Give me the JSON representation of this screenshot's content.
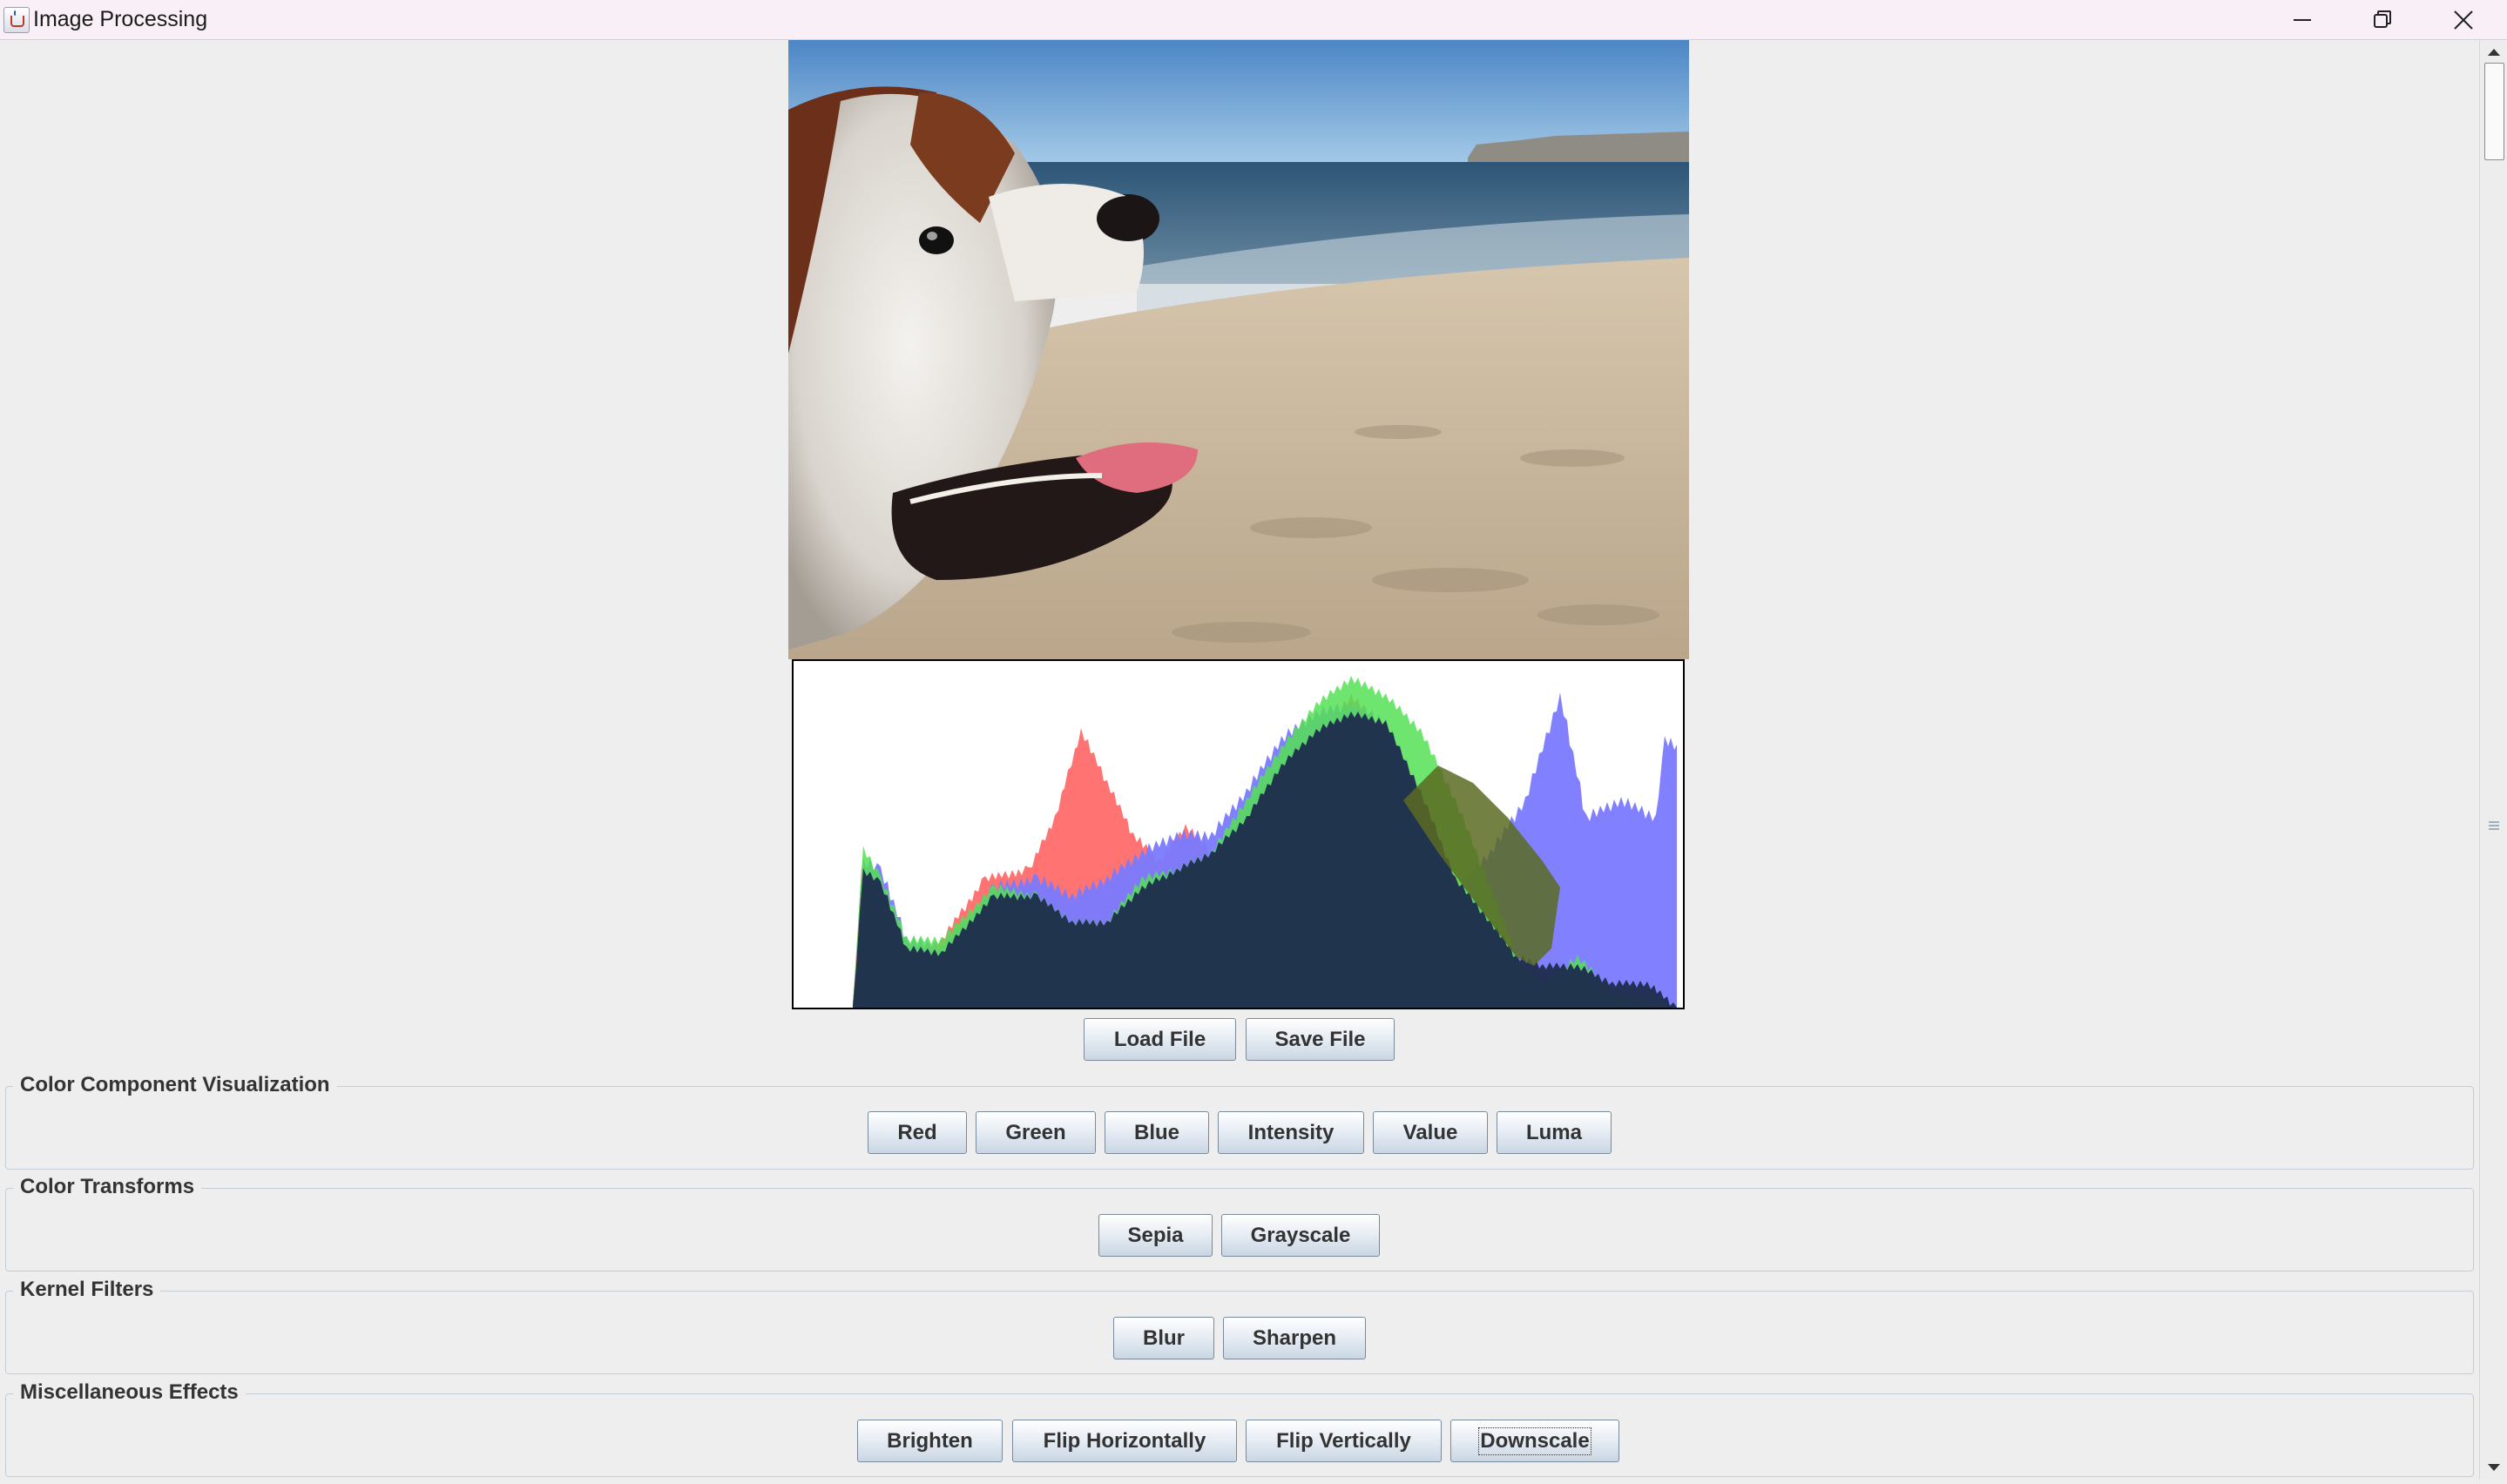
{
  "window": {
    "title": "Image Processing",
    "app_icon": "java-cup-icon",
    "controls": [
      "minimize-icon",
      "maximize-icon",
      "close-icon"
    ]
  },
  "image_panel": {
    "content": "photo of a spaniel on a sandy beach with ocean and sky"
  },
  "histogram": {
    "channels": [
      "red",
      "green",
      "blue",
      "intensity"
    ]
  },
  "file_buttons": {
    "load": "Load File",
    "save": "Save File"
  },
  "groups": {
    "color_component": {
      "title": "Color Component Visualization",
      "buttons": {
        "red": "Red",
        "green": "Green",
        "blue": "Blue",
        "intensity": "Intensity",
        "value": "Value",
        "luma": "Luma"
      }
    },
    "color_transforms": {
      "title": "Color Transforms",
      "buttons": {
        "sepia": "Sepia",
        "grayscale": "Grayscale"
      }
    },
    "kernel_filters": {
      "title": "Kernel Filters",
      "buttons": {
        "blur": "Blur",
        "sharpen": "Sharpen"
      }
    },
    "misc_effects": {
      "title": "Miscellaneous Effects",
      "buttons": {
        "brighten": "Brighten",
        "flip_h": "Flip Horizontally",
        "flip_v": "Flip Vertically",
        "downscale": "Downscale"
      }
    }
  },
  "colors": {
    "button_border": "#7a8a99",
    "panel_bg": "#eeeeee",
    "hist_red": "#ff6b6b",
    "hist_green": "#55e055",
    "hist_blue": "#7a7aff",
    "hist_dark": "#1f2b4d"
  }
}
